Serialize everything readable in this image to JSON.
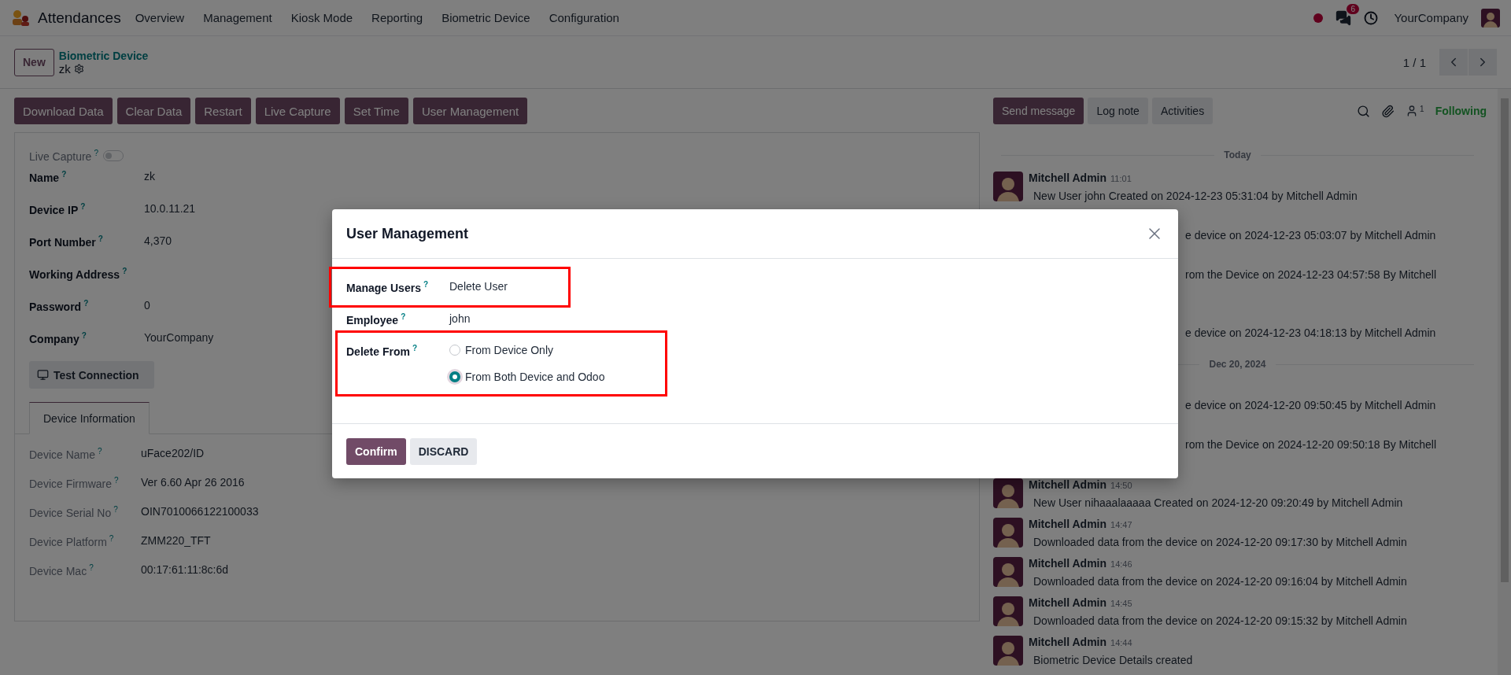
{
  "app": {
    "name": "Attendances",
    "menu": [
      "Overview",
      "Management",
      "Kiosk Mode",
      "Reporting",
      "Biometric Device",
      "Configuration"
    ],
    "chat_badge": "6",
    "company": "YourCompany"
  },
  "control_panel": {
    "new_button": "New",
    "breadcrumb": "Biometric Device",
    "record": "zk",
    "pager": "1 / 1"
  },
  "actions": [
    "Download Data",
    "Clear Data",
    "Restart",
    "Live Capture",
    "Set Time",
    "User Management"
  ],
  "form": {
    "toggle": {
      "label": "Live Capture",
      "hint": "?",
      "on": false
    },
    "fields": [
      {
        "label": "Name",
        "hint": "?",
        "value": "zk"
      },
      {
        "label": "Device IP",
        "hint": "?",
        "value": "10.0.11.21"
      },
      {
        "label": "Port Number",
        "hint": "?",
        "value": "4,370"
      },
      {
        "label": "Working Address",
        "hint": "?"
      },
      {
        "label": "Password",
        "hint": "?",
        "value": "0"
      },
      {
        "label": "Company",
        "hint": "?",
        "value": "YourCompany"
      }
    ],
    "test_button": "Test Connection",
    "tabs": [
      {
        "label": "Device Information",
        "selected": true
      }
    ],
    "info_fields": [
      {
        "label": "Device Name",
        "hint": "?",
        "value": "uFace202/ID"
      },
      {
        "label": "Device Firmware",
        "hint": "?",
        "value": "Ver 6.60 Apr 26 2016"
      },
      {
        "label": "Device Serial No",
        "hint": "?",
        "value": "OIN7010066122100033"
      },
      {
        "label": "Device Platform",
        "hint": "?",
        "value": "ZMM220_TFT"
      },
      {
        "label": "Device Mac",
        "hint": "?",
        "value": "00:17:61:11:8c:6d"
      }
    ]
  },
  "chatter": {
    "buttons": [
      {
        "label": "Send message",
        "kind": "primary"
      },
      {
        "label": "Log note",
        "kind": "secondary"
      },
      {
        "label": "Activities",
        "kind": "secondary"
      }
    ],
    "followers": "1",
    "follow_status": "Following",
    "feed": [
      {
        "kind": "separator",
        "label": "Today"
      },
      {
        "kind": "message",
        "author": "Mitchell Admin",
        "time": "11:01",
        "text": "New User john Created on 2024-12-23 05:31:04 by Mitchell Admin"
      },
      {
        "kind": "partial",
        "text": "e device on 2024-12-23 05:03:07 by Mitchell Admin"
      },
      {
        "kind": "partial",
        "text": "rom the Device on 2024-12-23 04:57:58 By Mitchell",
        "wraps": true
      },
      {
        "kind": "partial",
        "text": "e device on 2024-12-23 04:18:13 by Mitchell Admin"
      },
      {
        "kind": "separator",
        "label": "Dec 20, 2024"
      },
      {
        "kind": "partial",
        "text": "e device on 2024-12-20 09:50:45 by Mitchell Admin"
      },
      {
        "kind": "partial",
        "text": "rom the Device on 2024-12-20 09:50:18 By Mitchell",
        "wraps": true
      },
      {
        "kind": "message",
        "author": "Mitchell Admin",
        "time": "14:50",
        "text": "New User nihaaalaaaaa Created on 2024-12-20 09:20:49 by Mitchell Admin"
      },
      {
        "kind": "message",
        "author": "Mitchell Admin",
        "time": "14:47",
        "text": "Downloaded data from the device on 2024-12-20 09:17:30 by Mitchell Admin"
      },
      {
        "kind": "message",
        "author": "Mitchell Admin",
        "time": "14:46",
        "text": "Downloaded data from the device on 2024-12-20 09:16:04 by Mitchell Admin"
      },
      {
        "kind": "message",
        "author": "Mitchell Admin",
        "time": "14:45",
        "text": "Downloaded data from the device on 2024-12-20 09:15:32 by Mitchell Admin"
      },
      {
        "kind": "message",
        "author": "Mitchell Admin",
        "time": "14:44",
        "text": "Biometric Device Details created"
      }
    ]
  },
  "dialog": {
    "title": "User Management",
    "fields": [
      {
        "label": "Manage Users",
        "hint": "?",
        "value": "Delete User",
        "highlighted": true
      },
      {
        "label": "Employee",
        "hint": "?",
        "value": "john",
        "highlighted": false
      },
      {
        "label": "Delete From",
        "hint": "?",
        "highlighted": true,
        "options": [
          {
            "label": "From Device Only",
            "selected": false
          },
          {
            "label": "From Both Device and Odoo",
            "selected": true
          }
        ]
      }
    ],
    "buttons": [
      {
        "label": "Confirm",
        "kind": "primary"
      },
      {
        "label": "DISCARD",
        "kind": "secondary"
      }
    ]
  }
}
